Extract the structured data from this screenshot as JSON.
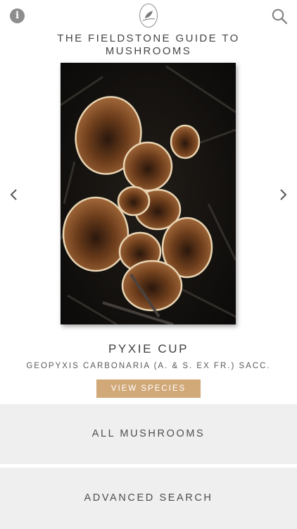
{
  "header": {
    "info_icon_glyph": "i",
    "info_icon": "info-icon",
    "logo_icon": "bird-on-branch-icon",
    "search_icon": "search-icon",
    "title": "THE FIELDSTONE GUIDE TO MUSHROOMS"
  },
  "featured": {
    "image_subject": "mushroom-photo",
    "common_name": "PYXIE CUP",
    "scientific_name": "GEOPYXIS CARBONARIA (A. & S. EX FR.) SACC.",
    "view_button_label": "VIEW SPECIES",
    "prev_icon": "chevron-left-icon",
    "next_icon": "chevron-right-icon"
  },
  "menu": {
    "all_mushrooms_label": "ALL MUSHROOMS",
    "advanced_search_label": "ADVANCED SEARCH"
  },
  "colors": {
    "accent": "#d1a878",
    "menu_background": "#efefef",
    "icon_gray": "#8d8d8d",
    "text": "#454545"
  }
}
